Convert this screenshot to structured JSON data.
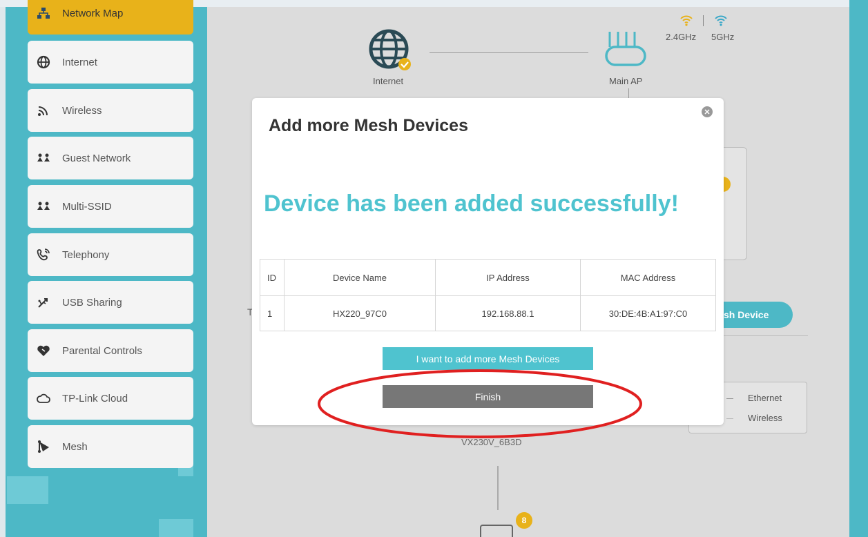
{
  "sidebar": {
    "items": [
      {
        "label": "Network Map",
        "icon": "network-map-icon",
        "active": true
      },
      {
        "label": "Internet",
        "icon": "globe-icon"
      },
      {
        "label": "Wireless",
        "icon": "wireless-icon"
      },
      {
        "label": "Guest Network",
        "icon": "guest-network-icon"
      },
      {
        "label": "Multi-SSID",
        "icon": "multi-ssid-icon"
      },
      {
        "label": "Telephony",
        "icon": "telephone-icon"
      },
      {
        "label": "USB Sharing",
        "icon": "usb-icon"
      },
      {
        "label": "Parental Controls",
        "icon": "heart-icon"
      },
      {
        "label": "TP-Link Cloud",
        "icon": "cloud-icon"
      },
      {
        "label": "Mesh",
        "icon": "mesh-icon"
      }
    ]
  },
  "network_map": {
    "internet_label": "Internet",
    "main_ap_label": "Main AP",
    "band_24": "2.4GHz",
    "band_5": "5GHz",
    "mesh_button_partial": "sh Device",
    "legend": {
      "ethernet": "Ethernet",
      "wireless": "Wireless"
    },
    "node_label_partial": "VX230V_6B3D",
    "client_count": "8",
    "partial_tab_char": "T"
  },
  "modal": {
    "title": "Add more Mesh Devices",
    "success_message": "Device has been added successfully!",
    "table": {
      "headers": [
        "ID",
        "Device Name",
        "IP Address",
        "MAC Address"
      ],
      "rows": [
        {
          "id": "1",
          "device_name": "HX220_97C0",
          "ip": "192.168.88.1",
          "mac": "30:DE:4B:A1:97:C0"
        }
      ]
    },
    "add_more_button": "I want to add more Mesh Devices",
    "finish_button": "Finish"
  },
  "colors": {
    "accent": "#4fc3cf",
    "active_nav": "#e8b21a",
    "finish_button": "#777777",
    "annotation": "#e02020"
  }
}
